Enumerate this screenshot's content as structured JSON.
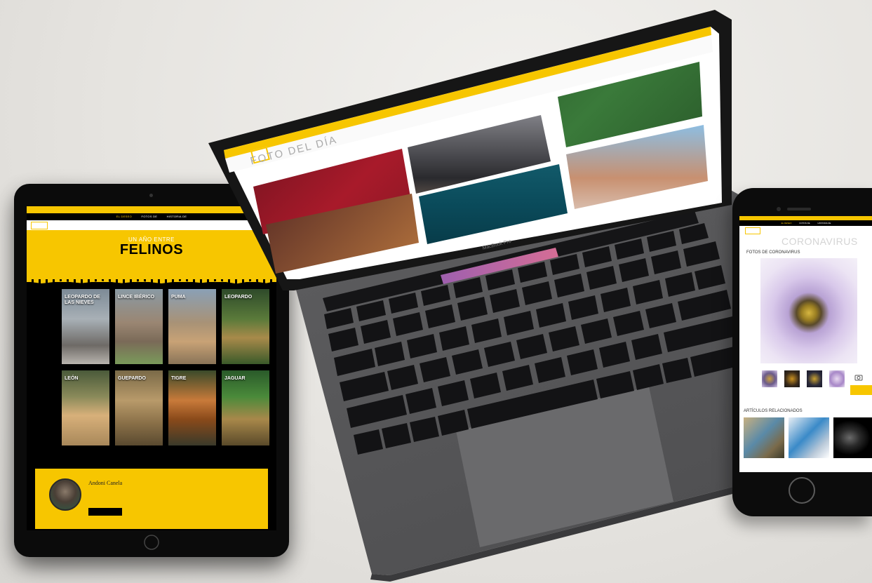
{
  "colors": {
    "brand_yellow": "#f7c600",
    "black": "#000000",
    "background": "#e9e7e3",
    "laptop_body": "#5c5c5e"
  },
  "tablet": {
    "top_nav": [
      "EL DESEO",
      "FOTOS DE",
      "HISTORIA DE"
    ],
    "hero_pre": "UN AÑO ENTRE",
    "hero_title": "FELINOS",
    "cards": [
      {
        "label": "LEOPARDO DE LAS NIEVES"
      },
      {
        "label": "LINCE IBÉRICO"
      },
      {
        "label": "PUMA"
      },
      {
        "label": "LEOPARDO"
      },
      {
        "label": "LEÓN"
      },
      {
        "label": "GUEPARDO"
      },
      {
        "label": "TIGRE"
      },
      {
        "label": "JAGUAR"
      }
    ],
    "author_name": "Andoni Canela"
  },
  "laptop": {
    "page_title": "FOTO DEL DÍA",
    "brand": "MacBook Pro"
  },
  "phone": {
    "top_nav": [
      "EL DESEO",
      "FOTOS DE",
      "HISTORIA DE"
    ],
    "category": "CORONAVIRUS",
    "heading": "FOTOS DE CORONAVIRUS",
    "related_heading": "ARTÍCULOS RELACIONADOS"
  }
}
